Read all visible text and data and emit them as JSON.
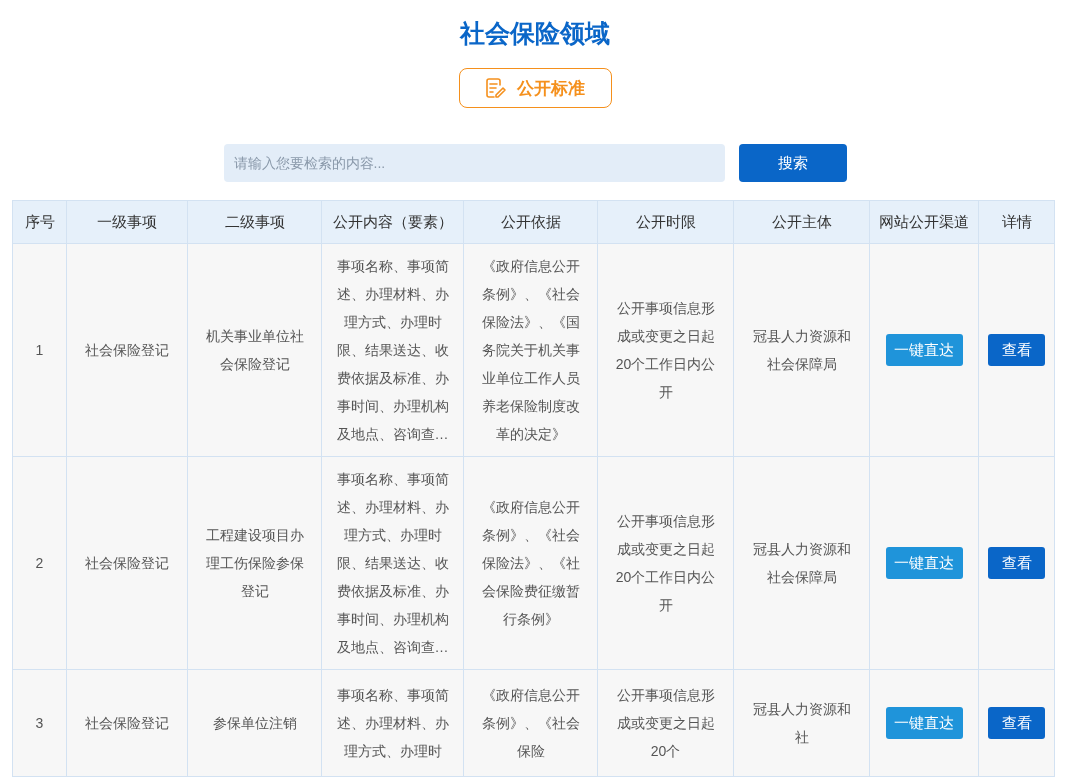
{
  "title": "社会保险领域",
  "standard_button": {
    "label": "公开标准"
  },
  "search": {
    "placeholder": "请输入您要检索的内容...",
    "button": "搜索"
  },
  "table": {
    "columns": [
      "序号",
      "一级事项",
      "二级事项",
      "公开内容（要素）",
      "公开依据",
      "公开时限",
      "公开主体",
      "网站公开渠道",
      "详情"
    ],
    "rows": [
      {
        "index": "1",
        "level1": "社会保险登记",
        "level2": "机关事业单位社会保险登记",
        "content": "事项名称、事项简述、办理材料、办理方式、办理时限、结果送达、收费依据及标准、办事时间、办理机构及地点、咨询查…",
        "basis": "《政府信息公开条例》、《社会保险法》、《国务院关于机关事业单位工作人员养老保险制度改革的决定》",
        "time_limit": "公开事项信息形成或变更之日起20个工作日内公开",
        "subject": "冠县人力资源和社会保障局",
        "channel_button": "一键直达",
        "detail_button": "查看"
      },
      {
        "index": "2",
        "level1": "社会保险登记",
        "level2": "工程建设项目办理工伤保险参保登记",
        "content": "事项名称、事项简述、办理材料、办理方式、办理时限、结果送达、收费依据及标准、办事时间、办理机构及地点、咨询查…",
        "basis": "《政府信息公开条例》、《社会保险法》、《社会保险费征缴暂行条例》",
        "time_limit": "公开事项信息形成或变更之日起20个工作日内公开",
        "subject": "冠县人力资源和社会保障局",
        "channel_button": "一键直达",
        "detail_button": "查看"
      },
      {
        "index": "3",
        "level1": "社会保险登记",
        "level2": "参保单位注销",
        "content": "事项名称、事项简述、办理材料、办理方式、办理时",
        "basis": "《政府信息公开条例》、《社会保险",
        "time_limit": "公开事项信息形成或变更之日起20个",
        "subject": "冠县人力资源和社",
        "channel_button": "一键直达",
        "detail_button": "查看"
      }
    ]
  }
}
